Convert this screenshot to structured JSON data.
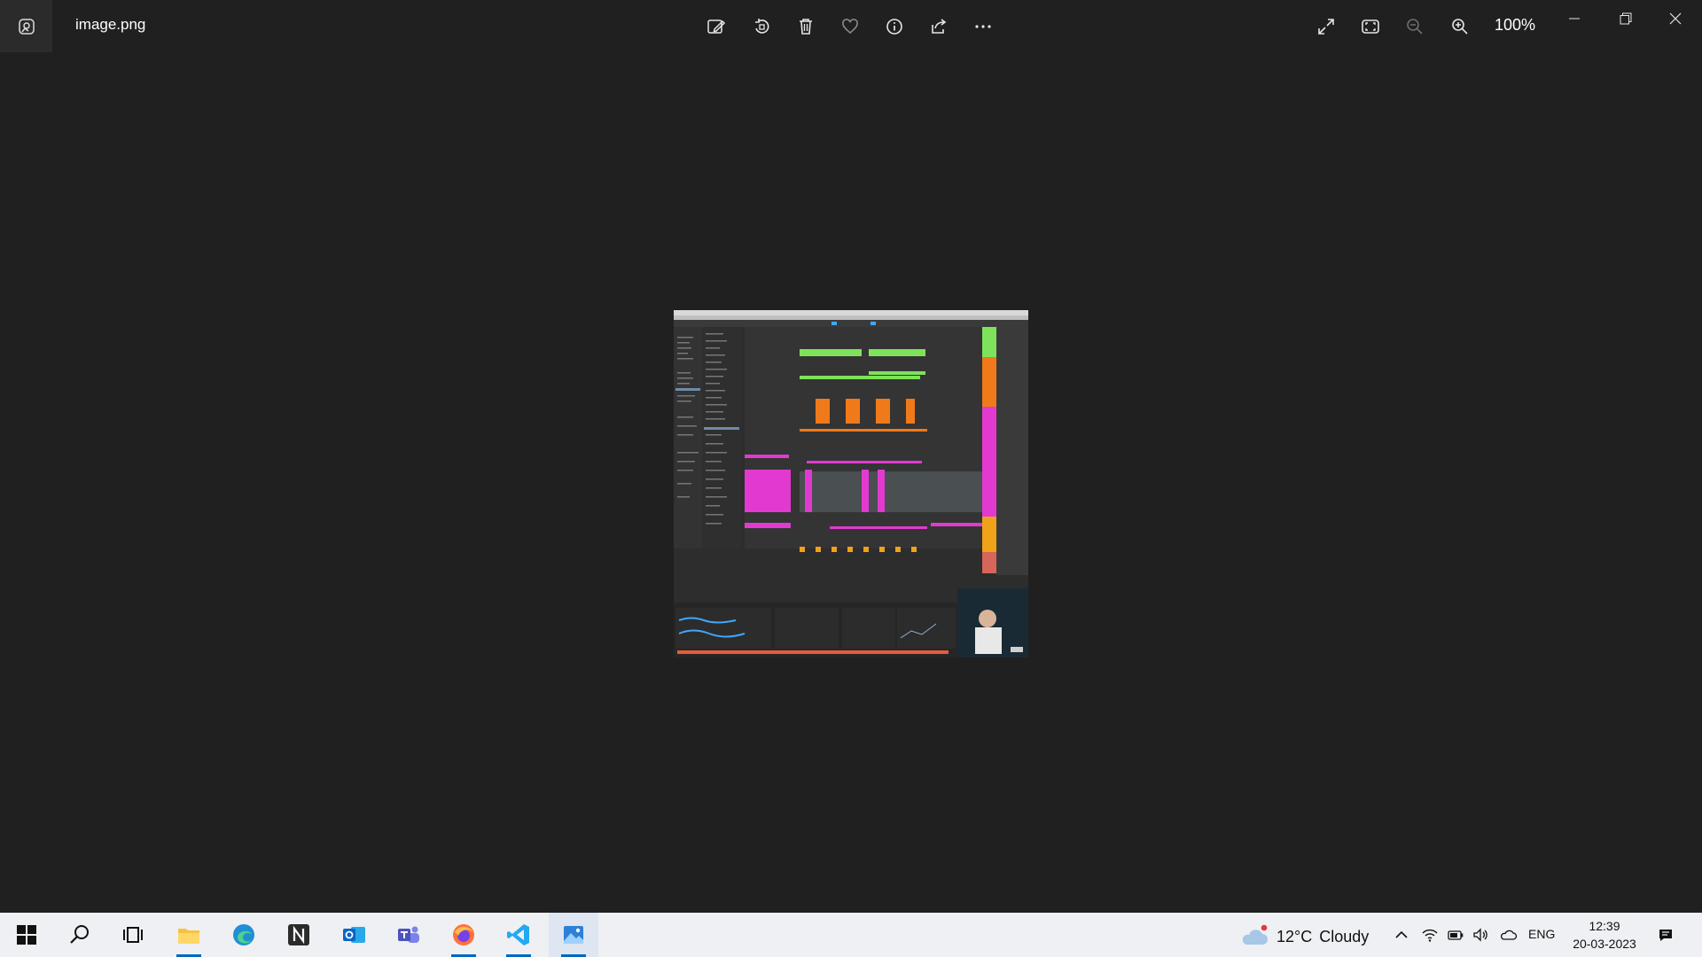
{
  "window": {
    "filename": "image.png",
    "zoom": "100%"
  },
  "toolbar": {
    "icons": [
      "edit-image-icon",
      "rotate-icon",
      "delete-icon",
      "favorite-icon",
      "info-icon",
      "share-icon",
      "more-icon"
    ],
    "right_icons": [
      "fullscreen-icon",
      "fit-to-window-icon",
      "zoom-out-icon",
      "zoom-in-icon"
    ]
  },
  "taskbar": {
    "apps": [
      "start",
      "search",
      "task-view",
      "file-explorer",
      "edge",
      "notion",
      "outlook",
      "teams",
      "firefox",
      "vscode",
      "photos"
    ],
    "weather": {
      "temp": "12°C",
      "condition": "Cloudy"
    },
    "lang": "ENG",
    "time": "12:39",
    "date": "20-03-2023"
  },
  "colors": {
    "bg": "#202020",
    "taskbar": "#eef0f3",
    "accent": "#0067c0",
    "daw_green": "#7ee35a",
    "daw_orange": "#f07a1a",
    "daw_magenta": "#e23ad0"
  }
}
